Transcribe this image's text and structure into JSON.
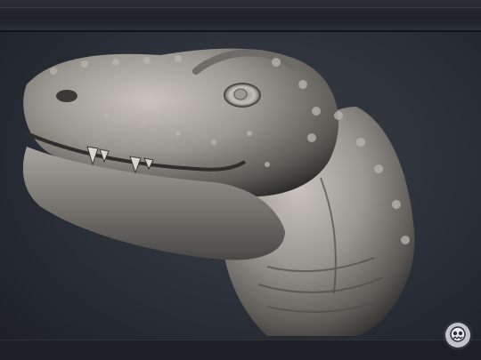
{
  "app": {
    "viewport_label": "",
    "background_color": "#2d323b",
    "model_color": "#9a9690"
  },
  "icons": {
    "logo": "skull-logo-icon"
  }
}
